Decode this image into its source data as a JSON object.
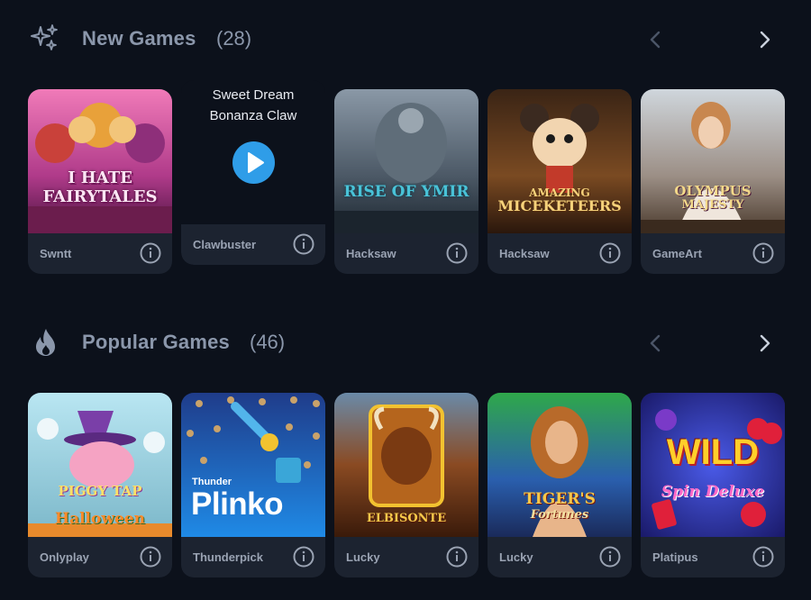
{
  "new_games": {
    "title": "New Games",
    "count": "(28)",
    "hovered": {
      "title_line1": "Sweet Dream",
      "title_line2": "Bonanza Claw"
    },
    "cards": [
      {
        "provider": "Swntt",
        "art": "I HATE FAIRYTALES"
      },
      {
        "provider": "Clawbuster"
      },
      {
        "provider": "Hacksaw",
        "art": "RISE OF YMIR"
      },
      {
        "provider": "Hacksaw",
        "art_line1": "AMAZING",
        "art_line2": "MICEKETEERS"
      },
      {
        "provider": "GameArt",
        "art_line1": "OLYMPUS",
        "art_line2": "MAJESTY"
      }
    ]
  },
  "popular_games": {
    "title": "Popular Games",
    "count": "(46)",
    "cards": [
      {
        "provider": "Onlyplay",
        "art_line1": "PIGGY TAP",
        "art_line2": "Halloween"
      },
      {
        "provider": "Thunderpick",
        "art_line1": "Thunder",
        "art_line2": "Plinko"
      },
      {
        "provider": "Lucky",
        "art": "ELBISONTE"
      },
      {
        "provider": "Lucky",
        "art_line1": "TIGER'S",
        "art_line2": "Fortunes"
      },
      {
        "provider": "Platipus",
        "art_line1": "WILD",
        "art_line2": "Spin Deluxe"
      }
    ]
  },
  "colors": {
    "background": "#0c111b",
    "card": "#1c2330",
    "accent": "#2f9de8",
    "muted_text": "#8b97ab"
  },
  "icons": {
    "new_games": "sparkles-icon",
    "popular_games": "flame-icon",
    "prev": "chevron-left-icon",
    "next": "chevron-right-icon",
    "info": "info-icon",
    "play": "play-icon"
  }
}
